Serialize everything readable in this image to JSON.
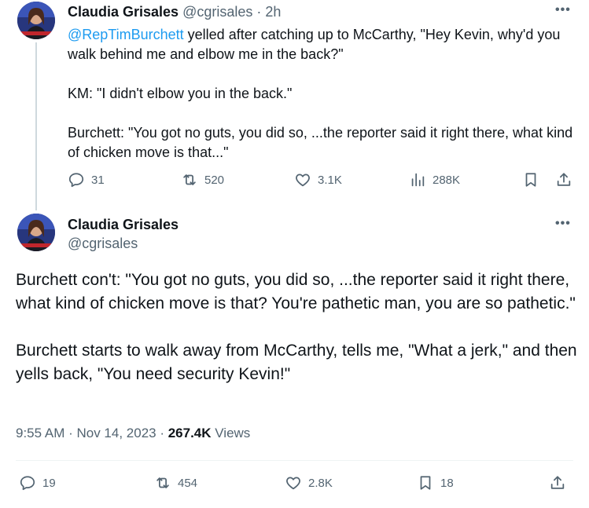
{
  "tweet1": {
    "author_name": "Claudia Grisales",
    "author_handle": "@cgrisales",
    "separator": "·",
    "time_ago": "2h",
    "more_label": "•••",
    "mention": "@RepTimBurchett",
    "line1_rest": " yelled after catching up to McCarthy,  \"Hey Kevin, why'd you walk behind me and elbow me in the back?\"",
    "line2": "KM: \"I didn't elbow you in the back.\"",
    "line3": "Burchett: \"You got no guts, you did so, ...the reporter said it right there, what kind of chicken move is that...\"",
    "replies": "31",
    "reposts": "520",
    "likes": "3.1K",
    "views": "288K"
  },
  "tweet2": {
    "author_name": "Claudia Grisales",
    "author_handle": "@cgrisales",
    "more_label": "•••",
    "para1": "Burchett con't: \"You got no guts, you did so, ...the reporter said it right there, what kind of chicken move is that? You're pathetic man, you are so pathetic.\"",
    "para2": "Burchett starts to walk away from McCarthy, tells me, \"What a jerk,\" and then yells back, \"You need security Kevin!\"",
    "timestamp": "9:55 AM · Nov 14, 2023",
    "meta_sep": " · ",
    "view_count": "267.4K",
    "views_label": " Views",
    "replies": "19",
    "reposts": "454",
    "likes": "2.8K",
    "bookmarks": "18"
  },
  "icons": {
    "reply": "reply-icon",
    "repost": "repost-icon",
    "like": "heart-icon",
    "views": "analytics-icon",
    "bookmark": "bookmark-icon",
    "share": "share-icon"
  },
  "colors": {
    "link": "#1d9bf0",
    "secondary_text": "#536471",
    "primary_text": "#0f1419",
    "thread_line": "#cfd9de"
  }
}
